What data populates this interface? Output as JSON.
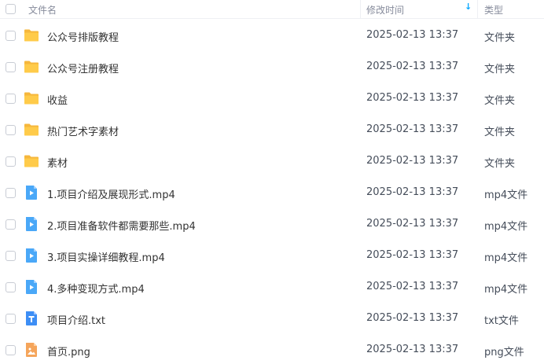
{
  "header": {
    "name_label": "文件名",
    "time_label": "修改时间",
    "type_label": "类型",
    "sort_arrow": "↓"
  },
  "files": [
    {
      "name": "公众号排版教程",
      "time": "2025-02-13 13:37",
      "type": "文件夹",
      "icon": "folder-icon"
    },
    {
      "name": "公众号注册教程",
      "time": "2025-02-13 13:37",
      "type": "文件夹",
      "icon": "folder-icon"
    },
    {
      "name": "收益",
      "time": "2025-02-13 13:37",
      "type": "文件夹",
      "icon": "folder-icon"
    },
    {
      "name": "热门艺术字素材",
      "time": "2025-02-13 13:37",
      "type": "文件夹",
      "icon": "folder-icon"
    },
    {
      "name": "素材",
      "time": "2025-02-13 13:37",
      "type": "文件夹",
      "icon": "folder-icon"
    },
    {
      "name": "1.项目介绍及展现形式.mp4",
      "time": "2025-02-13 13:37",
      "type": "mp4文件",
      "icon": "video-icon"
    },
    {
      "name": "2.项目准备软件都需要那些.mp4",
      "time": "2025-02-13 13:37",
      "type": "mp4文件",
      "icon": "video-icon"
    },
    {
      "name": "3.项目实操详细教程.mp4",
      "time": "2025-02-13 13:37",
      "type": "mp4文件",
      "icon": "video-icon"
    },
    {
      "name": "4.多种变现方式.mp4",
      "time": "2025-02-13 13:37",
      "type": "mp4文件",
      "icon": "video-icon"
    },
    {
      "name": "项目介绍.txt",
      "time": "2025-02-13 13:37",
      "type": "txt文件",
      "icon": "text-file-icon"
    },
    {
      "name": "首页.png",
      "time": "2025-02-13 13:37",
      "type": "png文件",
      "icon": "image-file-icon"
    }
  ]
}
